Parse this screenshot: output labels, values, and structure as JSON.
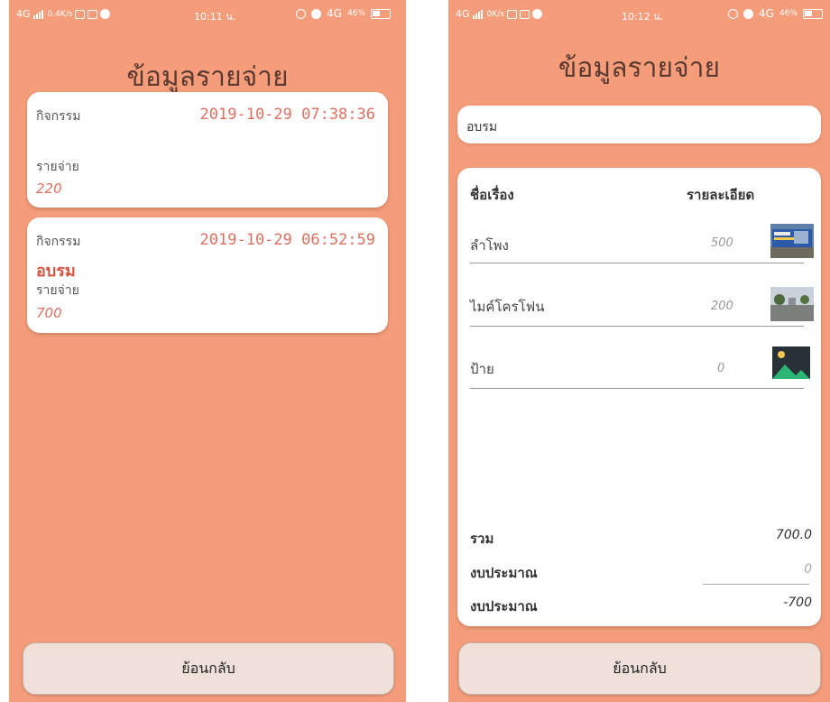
{
  "left_screen": {
    "status": {
      "network": "4G",
      "speed": "0.4K/s",
      "time": "10:11 น.",
      "net2": "4G",
      "battery": "46%"
    },
    "title": "ข้อมูลรายจ่าย",
    "cards": [
      {
        "activity_label": "กิจกรรม",
        "timestamp": "2019-10-29 07:38:36",
        "activity": "",
        "expense_label": "รายจ่าย",
        "amount": "220"
      },
      {
        "activity_label": "กิจกรรม",
        "timestamp": "2019-10-29 06:52:59",
        "activity": "อบรม",
        "expense_label": "รายจ่าย",
        "amount": "700"
      }
    ],
    "back_label": "ย้อนกลับ"
  },
  "right_screen": {
    "status": {
      "network": "4G",
      "speed": "0K/s",
      "time": "10:12 น.",
      "net2": "4G",
      "battery": "46%"
    },
    "title": "ข้อมูลรายจ่าย",
    "activity_value": "อบรม",
    "headers": {
      "name": "ชื่อเรื่อง",
      "detail": "รายละเอียด"
    },
    "items": [
      {
        "name": "ลำโพง",
        "price": "500",
        "image": "banner-photo"
      },
      {
        "name": "ไมค์โครโฟน",
        "price": "200",
        "image": "road-photo"
      },
      {
        "name": "ป้าย",
        "price": "0",
        "image": "placeholder-image-icon"
      }
    ],
    "totals": {
      "total_label": "รวม",
      "total_value": "700.0",
      "budget_label": "งบประมาณ",
      "budget_value": "0",
      "remain_label": "งบประมาณ",
      "remain_value": "-700"
    },
    "back_label": "ย้อนกลับ"
  },
  "colors": {
    "background": "#f59d7a",
    "accent": "#e07060",
    "button": "#efe0da"
  }
}
